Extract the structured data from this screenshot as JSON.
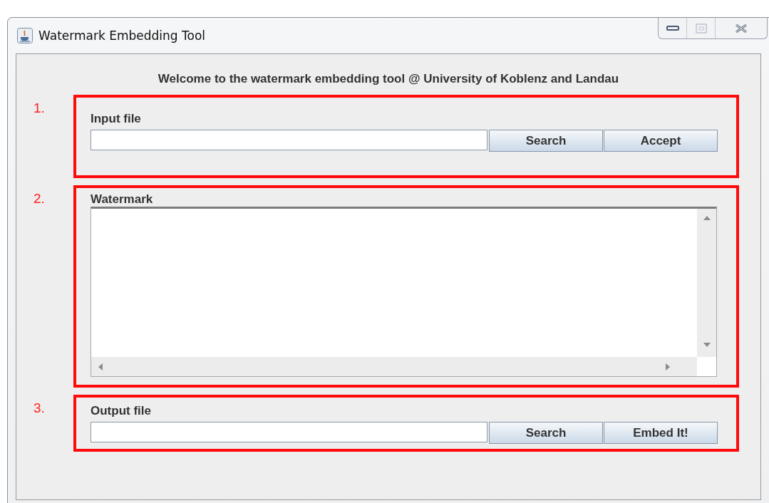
{
  "window": {
    "title": "Watermark Embedding Tool"
  },
  "welcome": "Welcome to the watermark embedding tool @ University of Koblenz and Landau",
  "sections": [
    {
      "number": "1.",
      "kind": "file",
      "label": "Input file",
      "buttons": [
        "Search",
        "Accept"
      ]
    },
    {
      "number": "2.",
      "kind": "text",
      "label": "Watermark"
    },
    {
      "number": "3.",
      "kind": "file",
      "label": "Output file",
      "buttons": [
        "Search",
        "Embed It!"
      ]
    }
  ]
}
